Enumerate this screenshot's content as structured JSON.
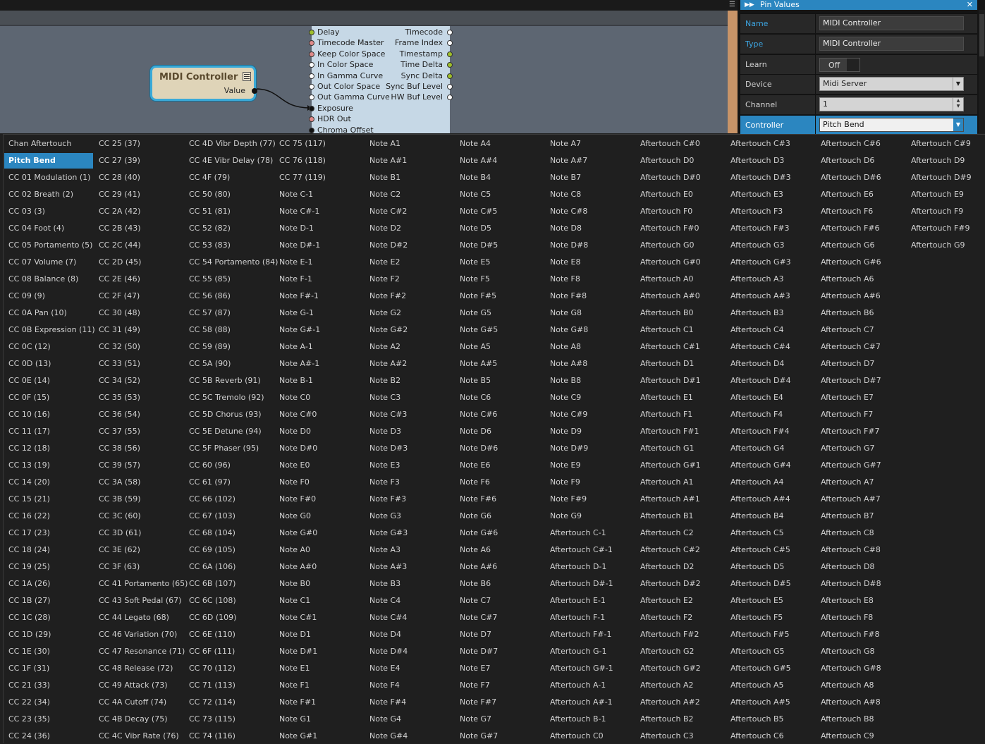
{
  "panel": {
    "title": "Pin Values",
    "rows": {
      "name": {
        "label": "Name",
        "value": "MIDI Controller"
      },
      "type": {
        "label": "Type",
        "value": "MIDI Controller"
      },
      "learn": {
        "label": "Learn",
        "value": "Off"
      },
      "device": {
        "label": "Device",
        "value": "Midi Server"
      },
      "channel": {
        "label": "Channel",
        "value": "1"
      },
      "controller": {
        "label": "Controller",
        "value": "Pitch Bend"
      }
    }
  },
  "nodes": {
    "midi_controller": {
      "title": "MIDI Controller",
      "output": "Value"
    },
    "video_node": {
      "inputs": [
        {
          "label": "Delay",
          "color": "#9fbf2a"
        },
        {
          "label": "Timecode Master",
          "color": "#e08a8a"
        },
        {
          "label": "Keep Color Space",
          "color": "#e08a8a"
        },
        {
          "label": "In Color Space",
          "color": "#ffffff"
        },
        {
          "label": "In Gamma Curve",
          "color": "#ffffff"
        },
        {
          "label": "Out Color Space",
          "color": "#ffffff"
        },
        {
          "label": "Out Gamma Curve",
          "color": "#ffffff"
        },
        {
          "label": "Exposure",
          "color": "#111111"
        },
        {
          "label": "HDR Out",
          "color": "#e08a8a"
        },
        {
          "label": "Chroma Offset",
          "color": "#111111"
        }
      ],
      "outputs": [
        {
          "label": "Timecode",
          "color": "#ffffff"
        },
        {
          "label": "Frame Index",
          "color": "#ffffff"
        },
        {
          "label": "Timestamp",
          "color": "#9fbf2a"
        },
        {
          "label": "Time Delta",
          "color": "#9fbf2a"
        },
        {
          "label": "Sync Delta",
          "color": "#9fbf2a"
        },
        {
          "label": "Sync Buf Level",
          "color": "#ffffff"
        },
        {
          "label": "HW Buf Level",
          "color": "#ffffff"
        }
      ]
    }
  },
  "selected_controller": "Pitch Bend",
  "controller_options": [
    [
      "Chan Aftertouch",
      "Pitch Bend",
      "CC 01 Modulation (1)",
      "CC 02 Breath (2)",
      "CC 03 (3)",
      "CC 04 Foot (4)",
      "CC 05 Portamento (5)",
      "CC 07 Volume (7)",
      "CC 08 Balance (8)",
      "CC 09 (9)",
      "CC 0A Pan (10)",
      "CC 0B Expression (11)",
      "CC 0C (12)",
      "CC 0D (13)",
      "CC 0E (14)",
      "CC 0F (15)",
      "CC 10 (16)",
      "CC 11 (17)",
      "CC 12 (18)",
      "CC 13 (19)",
      "CC 14 (20)",
      "CC 15 (21)",
      "CC 16 (22)",
      "CC 17 (23)",
      "CC 18 (24)",
      "CC 19 (25)",
      "CC 1A (26)",
      "CC 1B (27)",
      "CC 1C (28)",
      "CC 1D (29)",
      "CC 1E (30)",
      "CC 1F (31)",
      "CC 21 (33)",
      "CC 22 (34)",
      "CC 23 (35)",
      "CC 24 (36)"
    ],
    [
      "CC 25 (37)",
      "CC 27 (39)",
      "CC 28 (40)",
      "CC 29 (41)",
      "CC 2A (42)",
      "CC 2B (43)",
      "CC 2C (44)",
      "CC 2D (45)",
      "CC 2E (46)",
      "CC 2F (47)",
      "CC 30 (48)",
      "CC 31 (49)",
      "CC 32 (50)",
      "CC 33 (51)",
      "CC 34 (52)",
      "CC 35 (53)",
      "CC 36 (54)",
      "CC 37 (55)",
      "CC 38 (56)",
      "CC 39 (57)",
      "CC 3A (58)",
      "CC 3B (59)",
      "CC 3C (60)",
      "CC 3D (61)",
      "CC 3E (62)",
      "CC 3F (63)",
      "CC 41 Portamento (65)",
      "CC 43 Soft Pedal (67)",
      "CC 44 Legato (68)",
      "CC 46 Variation (70)",
      "CC 47 Resonance (71)",
      "CC 48 Release (72)",
      "CC 49 Attack (73)",
      "CC 4A Cutoff (74)",
      "CC 4B Decay (75)",
      "CC 4C Vibr Rate (76)"
    ],
    [
      "CC 4D Vibr Depth (77)",
      "CC 4E Vibr Delay (78)",
      "CC 4F (79)",
      "CC 50 (80)",
      "CC 51 (81)",
      "CC 52 (82)",
      "CC 53 (83)",
      "CC 54 Portamento (84)",
      "CC 55 (85)",
      "CC 56 (86)",
      "CC 57 (87)",
      "CC 58 (88)",
      "CC 59 (89)",
      "CC 5A (90)",
      "CC 5B Reverb (91)",
      "CC 5C Tremolo (92)",
      "CC 5D Chorus (93)",
      "CC 5E Detune (94)",
      "CC 5F Phaser (95)",
      "CC 60 (96)",
      "CC 61 (97)",
      "CC 66 (102)",
      "CC 67 (103)",
      "CC 68 (104)",
      "CC 69 (105)",
      "CC 6A (106)",
      "CC 6B (107)",
      "CC 6C (108)",
      "CC 6D (109)",
      "CC 6E (110)",
      "CC 6F (111)",
      "CC 70 (112)",
      "CC 71 (113)",
      "CC 72 (114)",
      "CC 73 (115)",
      "CC 74 (116)"
    ],
    [
      "CC 75 (117)",
      "CC 76 (118)",
      "CC 77 (119)",
      "Note C-1",
      "Note C#-1",
      "Note D-1",
      "Note D#-1",
      "Note E-1",
      "Note F-1",
      "Note F#-1",
      "Note G-1",
      "Note G#-1",
      "Note A-1",
      "Note A#-1",
      "Note B-1",
      "Note C0",
      "Note C#0",
      "Note D0",
      "Note D#0",
      "Note E0",
      "Note F0",
      "Note F#0",
      "Note G0",
      "Note G#0",
      "Note A0",
      "Note A#0",
      "Note B0",
      "Note C1",
      "Note C#1",
      "Note D1",
      "Note D#1",
      "Note E1",
      "Note F1",
      "Note F#1",
      "Note G1",
      "Note G#1"
    ],
    [
      "Note A1",
      "Note A#1",
      "Note B1",
      "Note C2",
      "Note C#2",
      "Note D2",
      "Note D#2",
      "Note E2",
      "Note F2",
      "Note F#2",
      "Note G2",
      "Note G#2",
      "Note A2",
      "Note A#2",
      "Note B2",
      "Note C3",
      "Note C#3",
      "Note D3",
      "Note D#3",
      "Note E3",
      "Note F3",
      "Note F#3",
      "Note G3",
      "Note G#3",
      "Note A3",
      "Note A#3",
      "Note B3",
      "Note C4",
      "Note C#4",
      "Note D4",
      "Note D#4",
      "Note E4",
      "Note F4",
      "Note F#4",
      "Note G4",
      "Note G#4"
    ],
    [
      "Note A4",
      "Note A#4",
      "Note B4",
      "Note C5",
      "Note C#5",
      "Note D5",
      "Note D#5",
      "Note E5",
      "Note F5",
      "Note F#5",
      "Note G5",
      "Note G#5",
      "Note A5",
      "Note A#5",
      "Note B5",
      "Note C6",
      "Note C#6",
      "Note D6",
      "Note D#6",
      "Note E6",
      "Note F6",
      "Note F#6",
      "Note G6",
      "Note G#6",
      "Note A6",
      "Note A#6",
      "Note B6",
      "Note C7",
      "Note C#7",
      "Note D7",
      "Note D#7",
      "Note E7",
      "Note F7",
      "Note F#7",
      "Note G7",
      "Note G#7"
    ],
    [
      "Note A7",
      "Note A#7",
      "Note B7",
      "Note C8",
      "Note C#8",
      "Note D8",
      "Note D#8",
      "Note E8",
      "Note F8",
      "Note F#8",
      "Note G8",
      "Note G#8",
      "Note A8",
      "Note A#8",
      "Note B8",
      "Note C9",
      "Note C#9",
      "Note D9",
      "Note D#9",
      "Note E9",
      "Note F9",
      "Note F#9",
      "Note G9",
      "Aftertouch C-1",
      "Aftertouch C#-1",
      "Aftertouch D-1",
      "Aftertouch D#-1",
      "Aftertouch E-1",
      "Aftertouch F-1",
      "Aftertouch F#-1",
      "Aftertouch G-1",
      "Aftertouch G#-1",
      "Aftertouch A-1",
      "Aftertouch A#-1",
      "Aftertouch B-1",
      "Aftertouch C0"
    ],
    [
      "Aftertouch C#0",
      "Aftertouch D0",
      "Aftertouch D#0",
      "Aftertouch E0",
      "Aftertouch F0",
      "Aftertouch F#0",
      "Aftertouch G0",
      "Aftertouch G#0",
      "Aftertouch A0",
      "Aftertouch A#0",
      "Aftertouch B0",
      "Aftertouch C1",
      "Aftertouch C#1",
      "Aftertouch D1",
      "Aftertouch D#1",
      "Aftertouch E1",
      "Aftertouch F1",
      "Aftertouch F#1",
      "Aftertouch G1",
      "Aftertouch G#1",
      "Aftertouch A1",
      "Aftertouch A#1",
      "Aftertouch B1",
      "Aftertouch C2",
      "Aftertouch C#2",
      "Aftertouch D2",
      "Aftertouch D#2",
      "Aftertouch E2",
      "Aftertouch F2",
      "Aftertouch F#2",
      "Aftertouch G2",
      "Aftertouch G#2",
      "Aftertouch A2",
      "Aftertouch A#2",
      "Aftertouch B2",
      "Aftertouch C3"
    ],
    [
      "Aftertouch C#3",
      "Aftertouch D3",
      "Aftertouch D#3",
      "Aftertouch E3",
      "Aftertouch F3",
      "Aftertouch F#3",
      "Aftertouch G3",
      "Aftertouch G#3",
      "Aftertouch A3",
      "Aftertouch A#3",
      "Aftertouch B3",
      "Aftertouch C4",
      "Aftertouch C#4",
      "Aftertouch D4",
      "Aftertouch D#4",
      "Aftertouch E4",
      "Aftertouch F4",
      "Aftertouch F#4",
      "Aftertouch G4",
      "Aftertouch G#4",
      "Aftertouch A4",
      "Aftertouch A#4",
      "Aftertouch B4",
      "Aftertouch C5",
      "Aftertouch C#5",
      "Aftertouch D5",
      "Aftertouch D#5",
      "Aftertouch E5",
      "Aftertouch F5",
      "Aftertouch F#5",
      "Aftertouch G5",
      "Aftertouch G#5",
      "Aftertouch A5",
      "Aftertouch A#5",
      "Aftertouch B5",
      "Aftertouch C6"
    ],
    [
      "Aftertouch C#6",
      "Aftertouch D6",
      "Aftertouch D#6",
      "Aftertouch E6",
      "Aftertouch F6",
      "Aftertouch F#6",
      "Aftertouch G6",
      "Aftertouch G#6",
      "Aftertouch A6",
      "Aftertouch A#6",
      "Aftertouch B6",
      "Aftertouch C7",
      "Aftertouch C#7",
      "Aftertouch D7",
      "Aftertouch D#7",
      "Aftertouch E7",
      "Aftertouch F7",
      "Aftertouch F#7",
      "Aftertouch G7",
      "Aftertouch G#7",
      "Aftertouch A7",
      "Aftertouch A#7",
      "Aftertouch B7",
      "Aftertouch C8",
      "Aftertouch C#8",
      "Aftertouch D8",
      "Aftertouch D#8",
      "Aftertouch E8",
      "Aftertouch F8",
      "Aftertouch F#8",
      "Aftertouch G8",
      "Aftertouch G#8",
      "Aftertouch A8",
      "Aftertouch A#8",
      "Aftertouch B8",
      "Aftertouch C9"
    ],
    [
      "Aftertouch C#9",
      "Aftertouch D9",
      "Aftertouch D#9",
      "Aftertouch E9",
      "Aftertouch F9",
      "Aftertouch F#9",
      "Aftertouch G9"
    ]
  ],
  "colors": {
    "accent": "#2b86c0",
    "node_selected_border": "#3aaad8"
  }
}
